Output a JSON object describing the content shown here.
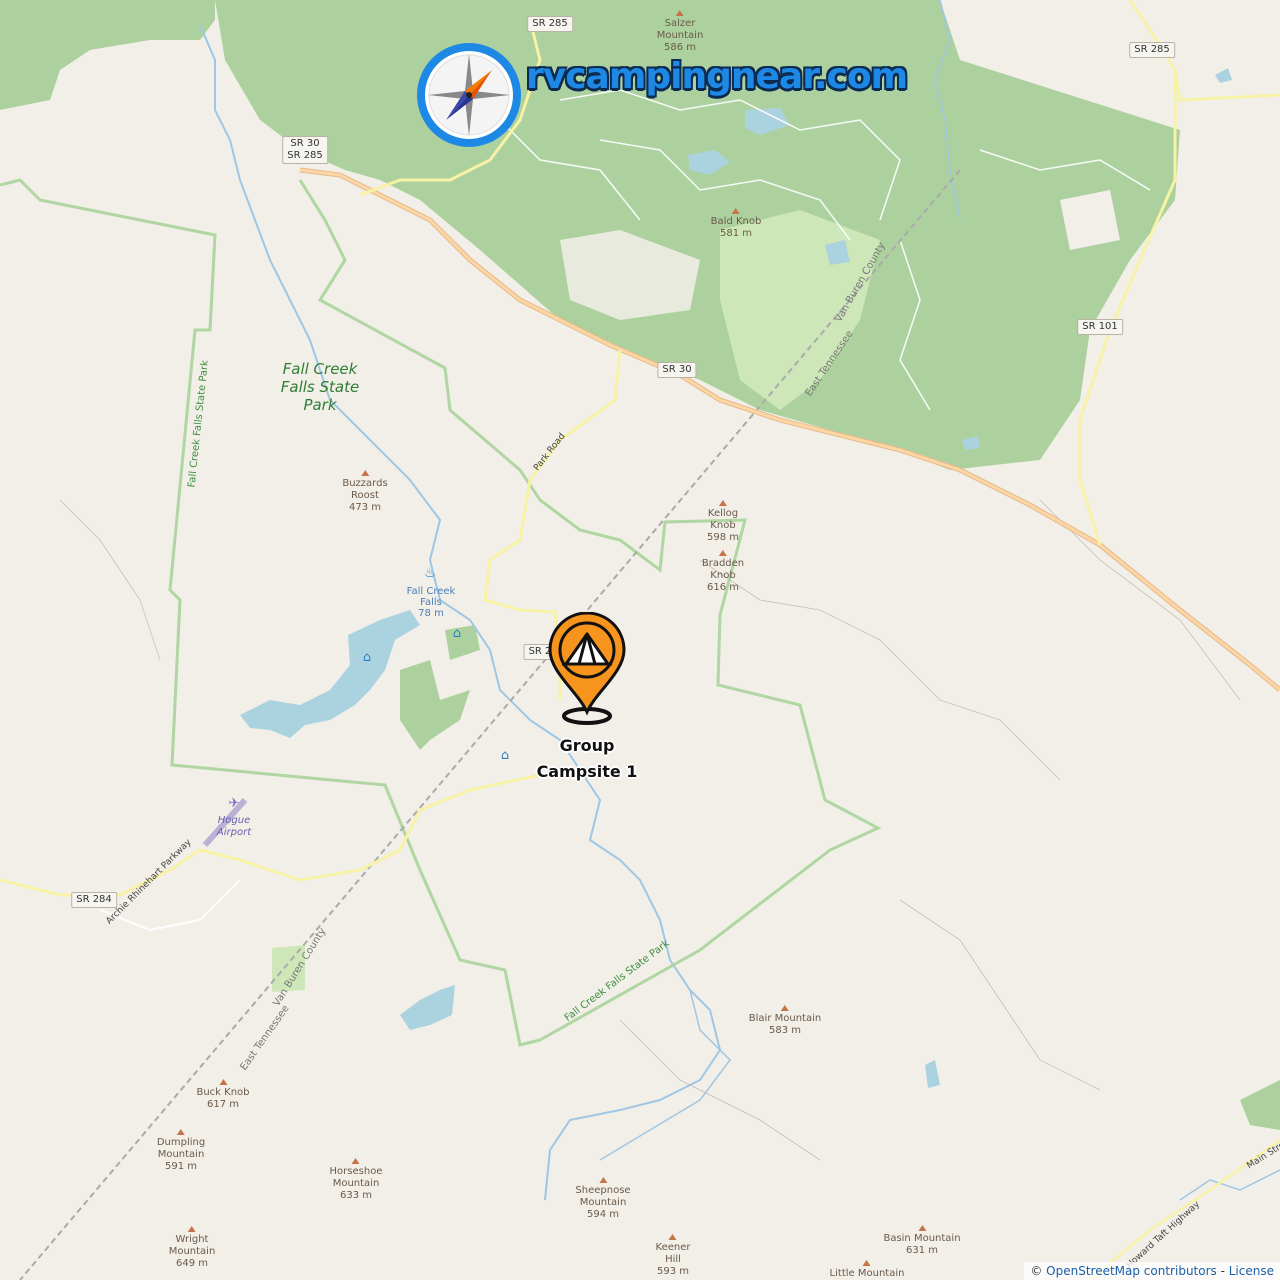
{
  "branding": {
    "site_name": "rvcampingnear.com",
    "logo_icon": "compass-icon"
  },
  "marker": {
    "label_line1": "Group",
    "label_line2": "Campsite 1",
    "icon": "tent-pin-icon",
    "color": "#f7941d"
  },
  "park_label": {
    "line1": "Fall Creek",
    "line2": "Falls State",
    "line3": "Park"
  },
  "airport": {
    "line1": "Hogue",
    "line2": "Airport",
    "icon": "airplane-icon"
  },
  "waterfall": {
    "line1": "Fall Creek",
    "line2": "Falls",
    "line3": "78 m",
    "icon": "waterfall-icon"
  },
  "peaks": [
    {
      "name": "Salzer\nMountain\n586 m"
    },
    {
      "name": "Bald Knob\n581 m"
    },
    {
      "name": "Buzzards\nRoost\n473 m"
    },
    {
      "name": "Kellog\nKnob\n598 m"
    },
    {
      "name": "Bradden\nKnob\n616 m"
    },
    {
      "name": "Blair Mountain\n583 m"
    },
    {
      "name": "Buck Knob\n617 m"
    },
    {
      "name": "Dumpling\nMountain\n591 m"
    },
    {
      "name": "Horseshoe\nMountain\n633 m"
    },
    {
      "name": "Sheepnose\nMountain\n594 m"
    },
    {
      "name": "Wright\nMountain\n649 m"
    },
    {
      "name": "Keener\nHill\n593 m"
    },
    {
      "name": "Basin Mountain\n631 m"
    },
    {
      "name": "Little Mountain"
    }
  ],
  "route_shields": [
    {
      "text": "SR 285"
    },
    {
      "text": "SR 285"
    },
    {
      "text": "SR 30\nSR 285"
    },
    {
      "text": "SR 30"
    },
    {
      "text": "SR 101"
    },
    {
      "text": "SR 284"
    },
    {
      "text": "SR 2"
    }
  ],
  "road_labels": {
    "park_road": "Park Road",
    "parkway": "Archie Rhinehart Parkway",
    "taft_highway": "Howard Taft Highway",
    "main_street": "Main Stree"
  },
  "boundary_labels": {
    "west": "Fall Creek Falls State Park",
    "south": "Fall Creek Falls State Park",
    "county_ne": "Van Buren County",
    "county_sw": "Van Buren County"
  },
  "rail_labels": {
    "ne": "East Tennessee",
    "sw": "East Tennessee"
  },
  "poi_icons": [
    "cabin-icon",
    "cabin-icon",
    "cabin-icon"
  ],
  "attribution": {
    "prefix": "©",
    "osm": "OpenStreetMap contributors",
    "separator": " - ",
    "license": "License"
  },
  "colors": {
    "land": "#f2efe9",
    "forest": "#add19e",
    "water": "#aad3df",
    "major_road": "#fcd6a4",
    "marker": "#f7941d",
    "brand_blue": "#1e88e5"
  }
}
